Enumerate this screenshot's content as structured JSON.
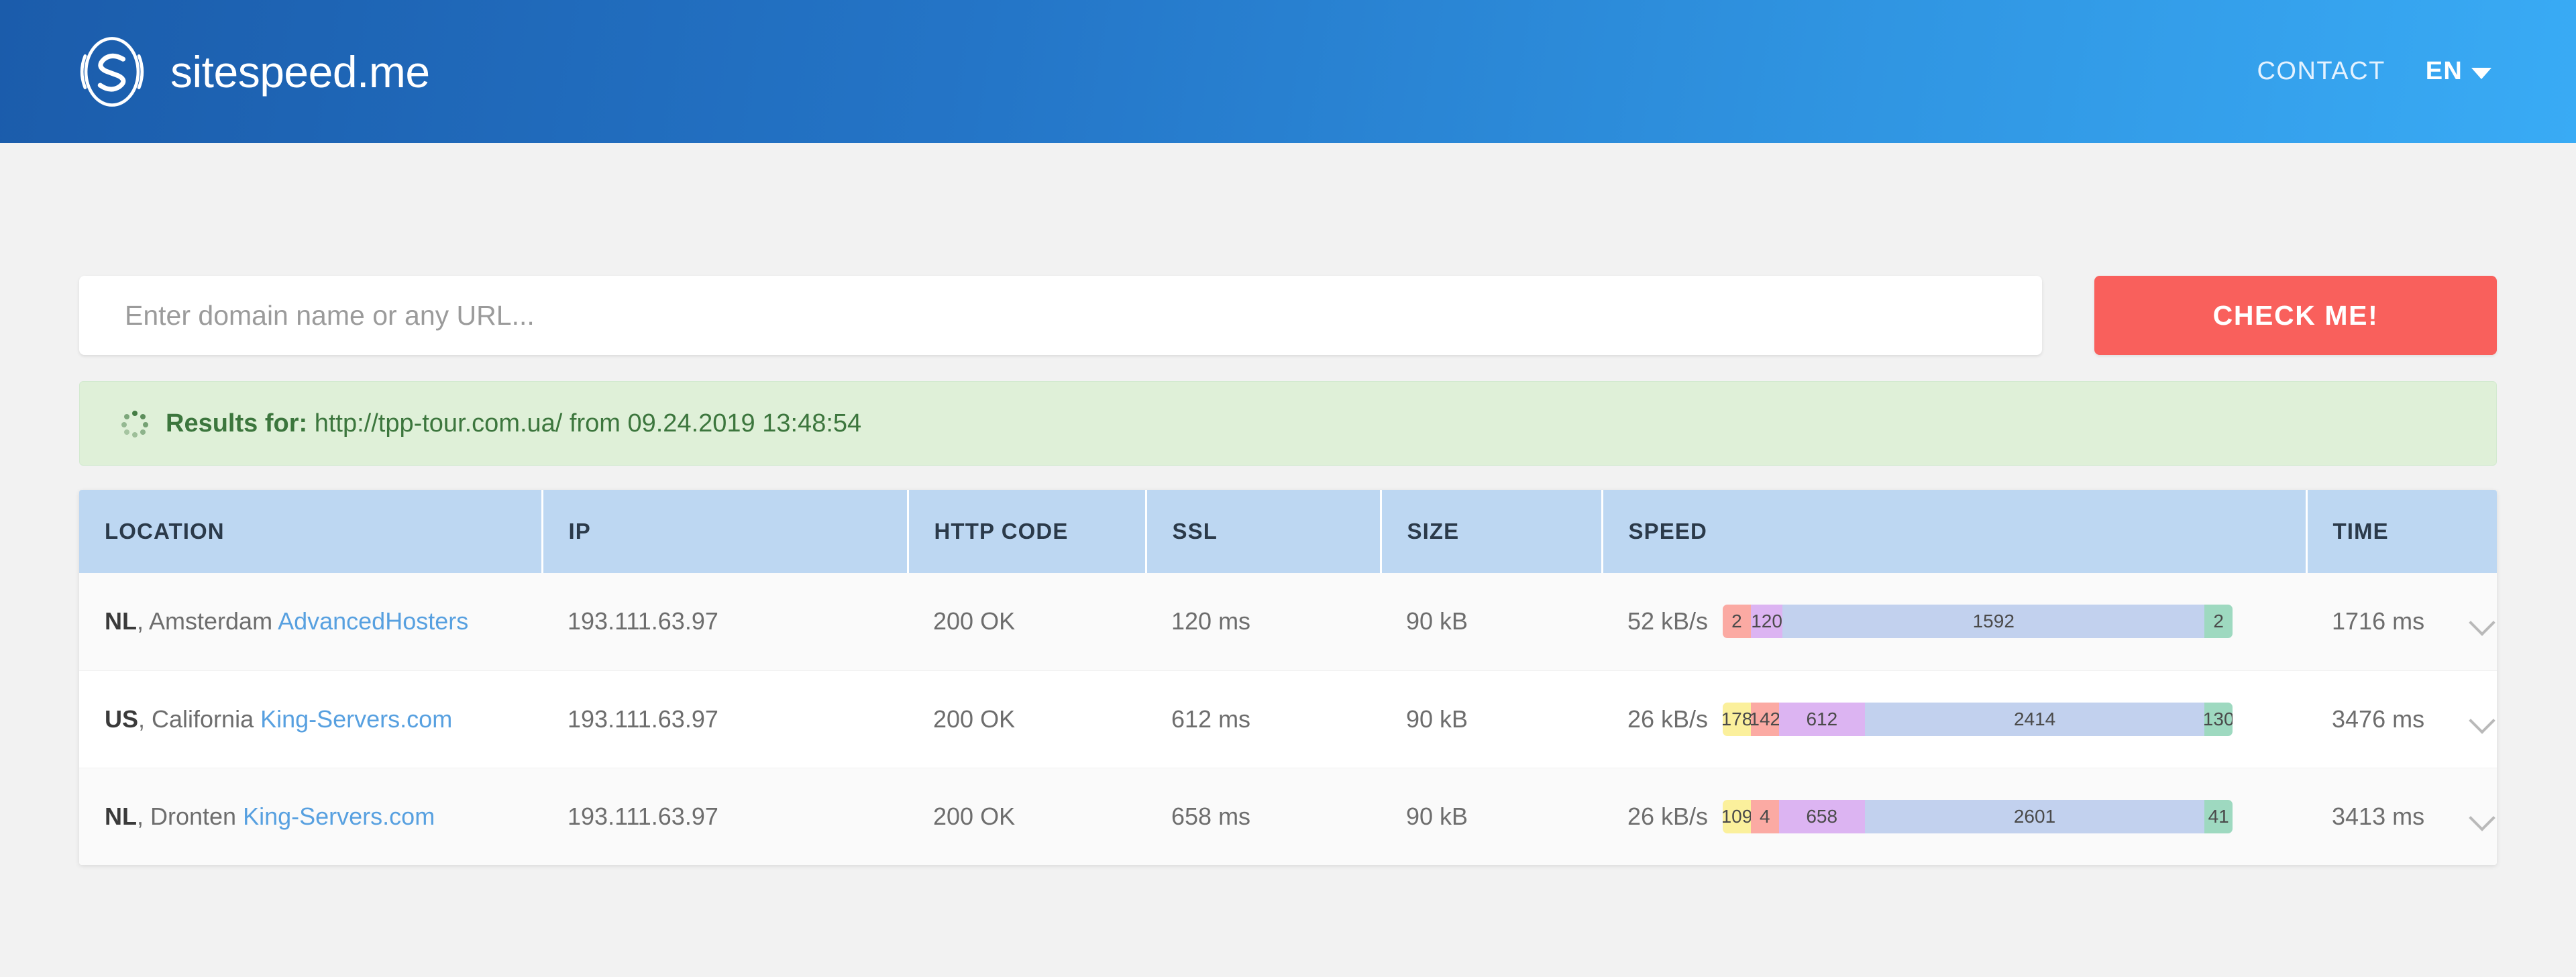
{
  "header": {
    "brand_name": "sitespeed.me",
    "logo_icon": "sitespeed-circle-s-logo",
    "nav": {
      "contact_label": "CONTACT",
      "language_label": "EN",
      "language_caret_icon": "caret-down-icon"
    },
    "gradient_from": "#1b5cab",
    "gradient_to": "#39abf5"
  },
  "search": {
    "placeholder": "Enter domain name or any URL...",
    "value": "",
    "button_label": "CHECK ME!",
    "button_color": "#f9605c"
  },
  "banner": {
    "spinner_icon": "loading-spinner-icon",
    "label": "Results for:",
    "url": "http://tpp-tour.com.ua/",
    "from_word": "from",
    "date": "09.24.2019",
    "time": "13:48:54",
    "background": "#dff0d8",
    "text_color": "#3c763d"
  },
  "table": {
    "header_background": "#bdd7f2",
    "columns": [
      {
        "key": "location",
        "label": "LOCATION"
      },
      {
        "key": "ip",
        "label": "IP"
      },
      {
        "key": "http_code",
        "label": "HTTP CODE"
      },
      {
        "key": "ssl",
        "label": "SSL"
      },
      {
        "key": "size",
        "label": "SIZE"
      },
      {
        "key": "speed",
        "label": "SPEED"
      },
      {
        "key": "time",
        "label": "TIME"
      }
    ],
    "rows": [
      {
        "country": "NL",
        "city": ", Amsterdam ",
        "host": "AdvancedHosters",
        "ip": "193.111.63.97",
        "http_code": "200 OK",
        "ssl": "120 ms",
        "size": "90 kB",
        "speed_label": "52 kB/s",
        "time": "1716 ms",
        "expand_icon": "chevron-down-icon",
        "segments": [
          {
            "color": "#fbaaa3",
            "label": "2",
            "value": 2
          },
          {
            "color": "#dcb4f2",
            "label": "120",
            "value": 120
          },
          {
            "color": "#c2d1ee",
            "label": "1592",
            "value": 1592
          },
          {
            "color": "#9ed9c0",
            "label": "2",
            "value": 2
          }
        ]
      },
      {
        "country": "US",
        "city": ", California ",
        "host": "King-Servers.com",
        "ip": "193.111.63.97",
        "http_code": "200 OK",
        "ssl": "612 ms",
        "size": "90 kB",
        "speed_label": "26 kB/s",
        "time": "3476 ms",
        "expand_icon": "chevron-down-icon",
        "segments": [
          {
            "color": "#fbf09c",
            "label": "178",
            "value": 178
          },
          {
            "color": "#fbaaa3",
            "label": "142",
            "value": 142
          },
          {
            "color": "#dcb4f2",
            "label": "612",
            "value": 612
          },
          {
            "color": "#c2d1ee",
            "label": "2414",
            "value": 2414
          },
          {
            "color": "#9ed9c0",
            "label": "130",
            "value": 130
          }
        ]
      },
      {
        "country": "NL",
        "city": ", Dronten ",
        "host": "King-Servers.com",
        "ip": "193.111.63.97",
        "http_code": "200 OK",
        "ssl": "658 ms",
        "size": "90 kB",
        "speed_label": "26 kB/s",
        "time": "3413 ms",
        "expand_icon": "chevron-down-icon",
        "segments": [
          {
            "color": "#fbf09c",
            "label": "109",
            "value": 109
          },
          {
            "color": "#fbaaa3",
            "label": "4",
            "value": 4
          },
          {
            "color": "#dcb4f2",
            "label": "658",
            "value": 658
          },
          {
            "color": "#c2d1ee",
            "label": "2601",
            "value": 2601
          },
          {
            "color": "#9ed9c0",
            "label": "41",
            "value": 41
          }
        ]
      }
    ]
  }
}
